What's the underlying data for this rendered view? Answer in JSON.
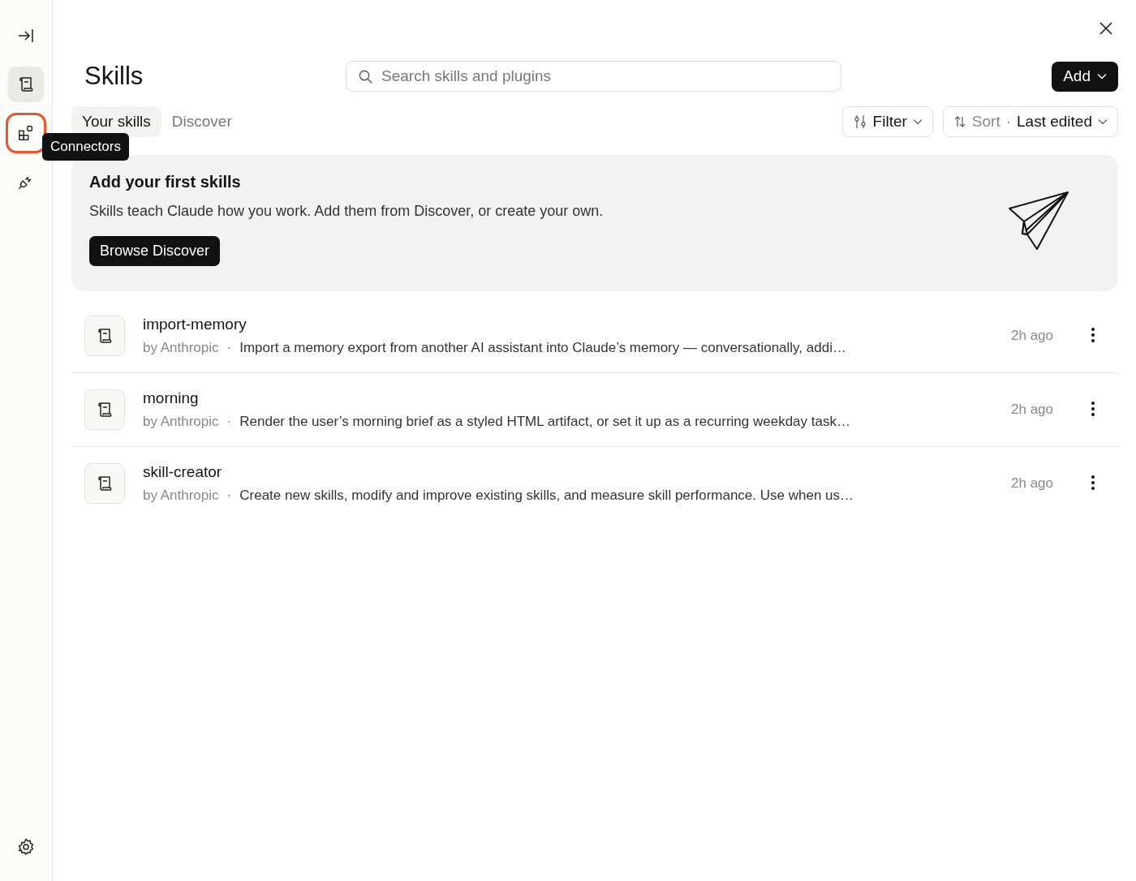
{
  "sidebar": {
    "items": [
      {
        "kind": "collapse",
        "selected": false,
        "focused": false
      },
      {
        "kind": "skills",
        "selected": true,
        "focused": false
      },
      {
        "kind": "connectors",
        "selected": false,
        "focused": true
      },
      {
        "kind": "plugins",
        "selected": false,
        "focused": false
      }
    ],
    "tooltip": "Connectors",
    "bottom": [
      {
        "kind": "settings",
        "selected": false,
        "focused": false
      }
    ]
  },
  "title": "Skills",
  "search": {
    "placeholder": "Search skills and plugins"
  },
  "add_button": "Add",
  "tabs": [
    {
      "label": "Your skills",
      "selected": true
    },
    {
      "label": "Discover",
      "selected": false
    }
  ],
  "filter": "Filter",
  "sort": {
    "label": "Sort",
    "separator": "·",
    "value": "Last edited"
  },
  "banner": {
    "title": "Add your first skills",
    "text": "Skills teach Claude how you work. Add them from Discover, or create your own.",
    "button": "Browse Discover"
  },
  "skills": [
    {
      "name": "import-memory",
      "author": "by Anthropic",
      "separator": "·",
      "description": "Import a memory export from another AI assistant into Claude’s memory — conversationally, addi…",
      "time": "2h ago"
    },
    {
      "name": "morning",
      "author": "by Anthropic",
      "separator": "·",
      "description": "Render the user’s morning brief as a styled HTML artifact, or set it up as a recurring weekday task…",
      "time": "2h ago"
    },
    {
      "name": "skill-creator",
      "author": "by Anthropic",
      "separator": "·",
      "description": "Create new skills, modify and improve existing skills, and measure skill performance. Use when us…",
      "time": "2h ago"
    }
  ]
}
